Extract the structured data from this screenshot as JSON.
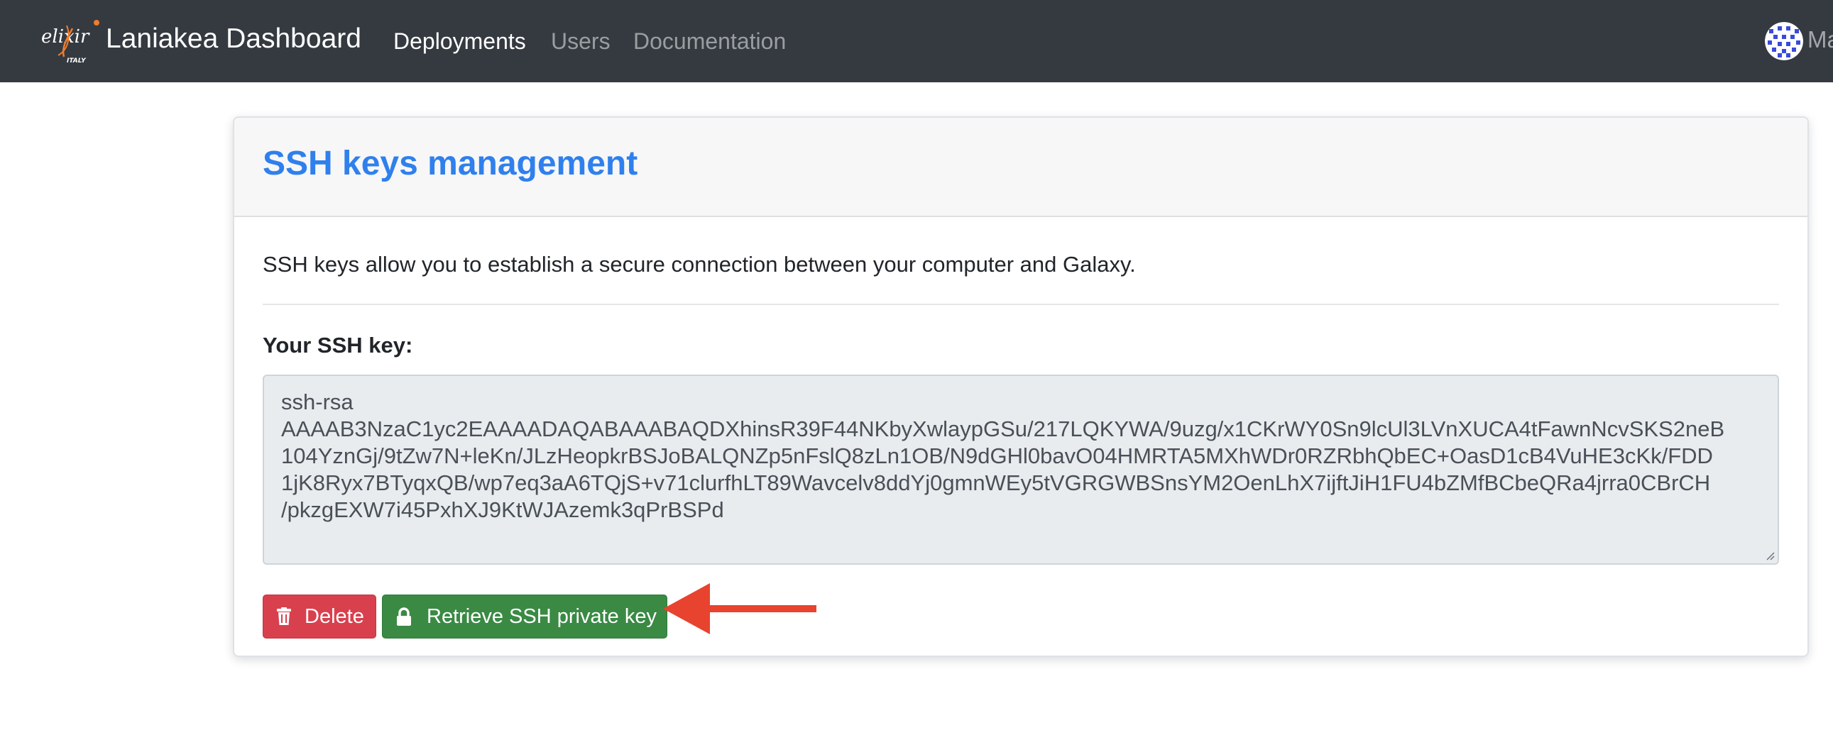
{
  "navbar": {
    "logo_text": "elixir",
    "logo_sub": "ITALY",
    "brand": "Laniakea Dashboard",
    "links": [
      {
        "label": "Deployments",
        "active": true
      },
      {
        "label": "Users",
        "active": false
      },
      {
        "label": "Documentation",
        "active": false
      }
    ],
    "user_name": "Ma"
  },
  "card": {
    "title": "SSH keys management",
    "intro": "SSH keys allow you to establish a secure connection between your computer and Galaxy.",
    "key_label": "Your SSH key:",
    "key_lines": [
      "ssh-rsa",
      "AAAAB3NzaC1yc2EAAAADAQABAAABAQDXhinsR39F44NKbyXwlaypGSu/217LQKYWA/9uzg/x1CKrWY0Sn9lcUl3LVnXUCA4tFawnNcvSKS2neB",
      "104YznGj/9tZw7N+leKn/JLzHeopkrBSJoBALQNZp5nFslQ8zLn1OB/N9dGHl0bavO04HMRTA5MXhWDr0RZRbhQbEC+OasD1cB4VuHE3cKk/FDD",
      "1jK8Ryx7BTyqxQB/wp7eq3aA6TQjS+v71clurfhLT89Wavcelv8ddYj0gmnWEy5tVGRGWBSnsYM2OenLhX7ijftJiH1FU4bZMfBCbeQRa4jrra0CBrCH",
      "/pkzgEXW7i45PxhXJ9KtWJAzemk3qPrBSPd"
    ],
    "delete_label": "Delete",
    "retrieve_label": "Retrieve SSH private key"
  },
  "colors": {
    "navbar": "#343a40",
    "title": "#2f80ed",
    "delete": "#d9404e",
    "retrieve": "#3a8a44",
    "arrow": "#e8432e"
  },
  "icons": [
    "trash-icon",
    "lock-icon",
    "avatar-icon"
  ]
}
